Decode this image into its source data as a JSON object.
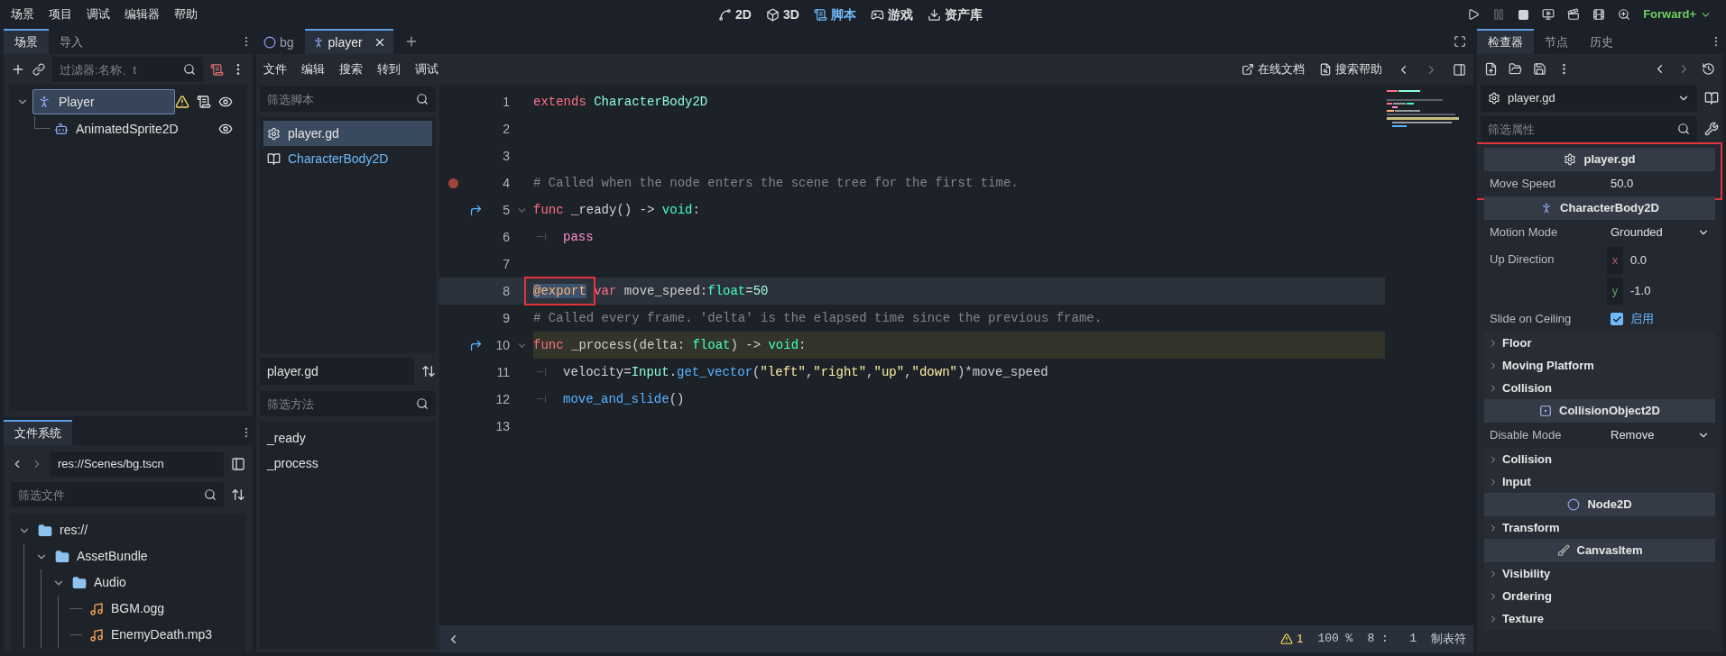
{
  "menu": [
    "场景",
    "项目",
    "调试",
    "编辑器",
    "帮助"
  ],
  "workspaces": [
    {
      "label": "2D",
      "kind": "plane",
      "selected": false
    },
    {
      "label": "3D",
      "kind": "space",
      "selected": false
    },
    {
      "label": "脚本",
      "kind": "script",
      "selected": true
    },
    {
      "label": "游戏",
      "kind": "game",
      "selected": false
    },
    {
      "label": "资产库",
      "kind": "assets",
      "selected": false
    }
  ],
  "renderer": "Forward+",
  "scene_dock": {
    "tabs": [
      {
        "label": "场景",
        "selected": true
      },
      {
        "label": "导入",
        "selected": false
      }
    ],
    "filter": {
      "placeholder": "过滤器:名称、t"
    },
    "tree": [
      {
        "label": "Player",
        "kind": "character",
        "selected": true,
        "warning": true,
        "script": true,
        "expanded": true,
        "children": [
          {
            "label": "AnimatedSprite2D",
            "kind": "sprite",
            "selected": false,
            "warning": false,
            "script": false,
            "expanded": false
          }
        ]
      }
    ]
  },
  "filesystem": {
    "tabs": [
      {
        "label": "文件系统",
        "selected": true
      }
    ],
    "path": "res://Scenes/bg.tscn",
    "filter": {
      "placeholder": "筛选文件"
    },
    "tree": [
      {
        "label": "res://",
        "kind": "folder",
        "expanded": true,
        "children": [
          {
            "label": "AssetBundle",
            "kind": "folder",
            "expanded": true,
            "children": [
              {
                "label": "Audio",
                "kind": "folder",
                "expanded": true,
                "children": [
                  {
                    "label": "BGM.ogg",
                    "kind": "audio",
                    "expanded": false
                  },
                  {
                    "label": "EnemyDeath.mp3",
                    "kind": "audio",
                    "expanded": false
                  }
                ]
              }
            ]
          }
        ]
      }
    ]
  },
  "editor_tabs": [
    {
      "label": "bg",
      "kind": "node2d",
      "selected": false
    },
    {
      "label": "player",
      "kind": "character",
      "selected": true
    }
  ],
  "script_menu": [
    "文件",
    "编辑",
    "搜索",
    "转到",
    "调试"
  ],
  "help_links": [
    {
      "label": "在线文档",
      "kind": "docs"
    },
    {
      "label": "搜索帮助",
      "kind": "help"
    }
  ],
  "scripts": {
    "filter": {
      "placeholder": "筛选脚本"
    },
    "items": [
      {
        "label": "player.gd",
        "kind": "script",
        "selected": true
      },
      {
        "label": "CharacterBody2D",
        "kind": "doc",
        "selected": false
      }
    ]
  },
  "methods": {
    "title": "player.gd",
    "filter": {
      "placeholder": "筛选方法"
    },
    "items": [
      "_ready",
      "_process"
    ]
  },
  "code": [
    {
      "number": "1",
      "breakpoint": false,
      "override": false,
      "foldable": false,
      "current": false,
      "highlighted": false,
      "indented": false,
      "tokens": [
        {
          "t": "extends ",
          "kind": "keyword"
        },
        {
          "t": "CharacterBody2D",
          "kind": "engine_type"
        }
      ]
    },
    {
      "number": "2",
      "breakpoint": false,
      "override": false,
      "foldable": false,
      "current": false,
      "highlighted": false,
      "indented": false
    },
    {
      "number": "3",
      "breakpoint": false,
      "override": false,
      "foldable": false,
      "current": false,
      "highlighted": false,
      "indented": false
    },
    {
      "number": "4",
      "breakpoint": true,
      "override": false,
      "foldable": false,
      "current": false,
      "highlighted": false,
      "indented": false,
      "tokens": [
        {
          "t": "# Called when the node enters the scene tree for the first time.",
          "kind": "comment"
        }
      ]
    },
    {
      "number": "5",
      "breakpoint": false,
      "override": true,
      "foldable": true,
      "current": false,
      "highlighted": false,
      "indented": false,
      "tokens": [
        {
          "t": "func",
          "kind": "keyword"
        },
        {
          "t": " _ready() -> ",
          "kind": "plain"
        },
        {
          "t": "void",
          "kind": "type"
        },
        {
          "t": ":",
          "kind": "plain"
        }
      ]
    },
    {
      "number": "6",
      "breakpoint": false,
      "override": false,
      "foldable": false,
      "current": false,
      "highlighted": false,
      "indented": true,
      "tokens": [
        {
          "t": "pass",
          "kind": "control"
        }
      ]
    },
    {
      "number": "7",
      "breakpoint": false,
      "override": false,
      "foldable": false,
      "current": false,
      "highlighted": false,
      "indented": false
    },
    {
      "number": "8",
      "breakpoint": false,
      "override": false,
      "foldable": false,
      "current": true,
      "highlighted": false,
      "indented": false,
      "tokens": [
        {
          "t": "@export",
          "kind": "selected_annotation"
        },
        {
          "t": " var",
          "kind": "keyword"
        },
        {
          "t": " move_speed:",
          "kind": "plain"
        },
        {
          "t": "float",
          "kind": "type"
        },
        {
          "t": "=",
          "kind": "plain"
        },
        {
          "t": "50",
          "kind": "number"
        }
      ]
    },
    {
      "number": "9",
      "breakpoint": false,
      "override": false,
      "foldable": false,
      "current": false,
      "highlighted": false,
      "indented": false,
      "tokens": [
        {
          "t": "# Called every frame. 'delta' is the elapsed time since the previous frame.",
          "kind": "comment"
        }
      ]
    },
    {
      "number": "10",
      "breakpoint": false,
      "override": true,
      "foldable": true,
      "current": false,
      "highlighted": true,
      "indented": false,
      "tokens": [
        {
          "t": "func",
          "kind": "keyword"
        },
        {
          "t": " _process(delta: ",
          "kind": "plain"
        },
        {
          "t": "float",
          "kind": "type"
        },
        {
          "t": ") -> ",
          "kind": "plain"
        },
        {
          "t": "void",
          "kind": "type"
        },
        {
          "t": ":",
          "kind": "plain"
        }
      ]
    },
    {
      "number": "11",
      "breakpoint": false,
      "override": false,
      "foldable": false,
      "current": false,
      "highlighted": false,
      "indented": true,
      "tokens": [
        {
          "t": "velocity=",
          "kind": "plain"
        },
        {
          "t": "Input",
          "kind": "engine_type"
        },
        {
          "t": ".",
          "kind": "plain"
        },
        {
          "t": "get_vector",
          "kind": "function"
        },
        {
          "t": "(",
          "kind": "plain"
        },
        {
          "t": "\"left\"",
          "kind": "string"
        },
        {
          "t": ",",
          "kind": "plain"
        },
        {
          "t": "\"right\"",
          "kind": "string"
        },
        {
          "t": ",",
          "kind": "plain"
        },
        {
          "t": "\"up\"",
          "kind": "string"
        },
        {
          "t": ",",
          "kind": "plain"
        },
        {
          "t": "\"down\"",
          "kind": "string"
        },
        {
          "t": ")*move_speed",
          "kind": "plain"
        }
      ]
    },
    {
      "number": "12",
      "breakpoint": false,
      "override": false,
      "foldable": false,
      "current": false,
      "highlighted": false,
      "indented": true,
      "tokens": [
        {
          "t": "move_and_slide",
          "kind": "function"
        },
        {
          "t": "()",
          "kind": "plain"
        }
      ]
    },
    {
      "number": "13",
      "breakpoint": false,
      "override": false,
      "foldable": false,
      "current": false,
      "highlighted": false,
      "indented": false
    }
  ],
  "status_bar": {
    "warnings": "1",
    "zoom": "100 %",
    "position": "8 :   1",
    "indent_mode": "制表符"
  },
  "inspector": {
    "tabs": [
      {
        "label": "检查器",
        "selected": true
      },
      {
        "label": "节点",
        "selected": false
      },
      {
        "label": "历史",
        "selected": false
      }
    ],
    "object": "player.gd",
    "filter": {
      "placeholder": "筛选属性"
    },
    "categories": [
      {
        "title": "player.gd",
        "kind": "script",
        "marked": true,
        "rows": [
          {
            "kind": "number",
            "label": "Move Speed",
            "value": "50.0"
          }
        ]
      },
      {
        "title": "CharacterBody2D",
        "kind": "character",
        "marked": false,
        "rows": [
          {
            "kind": "enum",
            "label": "Motion Mode",
            "value": "Grounded"
          },
          {
            "kind": "vector",
            "label": "Up Direction",
            "components": [
              {
                "axis": "x",
                "value": "0.0"
              },
              {
                "axis": "y",
                "value": "-1.0"
              }
            ]
          },
          {
            "kind": "check",
            "label": "Slide on Ceiling",
            "checked": true,
            "text": "启用"
          },
          {
            "kind": "group",
            "label": "Floor"
          },
          {
            "kind": "group",
            "label": "Moving Platform"
          },
          {
            "kind": "group",
            "label": "Collision"
          }
        ]
      },
      {
        "title": "CollisionObject2D",
        "kind": "collision",
        "marked": false,
        "rows": [
          {
            "kind": "enum",
            "label": "Disable Mode",
            "value": "Remove"
          },
          {
            "kind": "group",
            "label": "Collision"
          },
          {
            "kind": "group",
            "label": "Input"
          }
        ]
      },
      {
        "title": "Node2D",
        "kind": "node2d",
        "marked": false,
        "rows": [
          {
            "kind": "group",
            "label": "Transform"
          }
        ]
      },
      {
        "title": "CanvasItem",
        "kind": "canvas",
        "marked": false,
        "rows": [
          {
            "kind": "group",
            "label": "Visibility"
          },
          {
            "kind": "group",
            "label": "Ordering"
          },
          {
            "kind": "group",
            "label": "Texture"
          }
        ]
      }
    ]
  }
}
